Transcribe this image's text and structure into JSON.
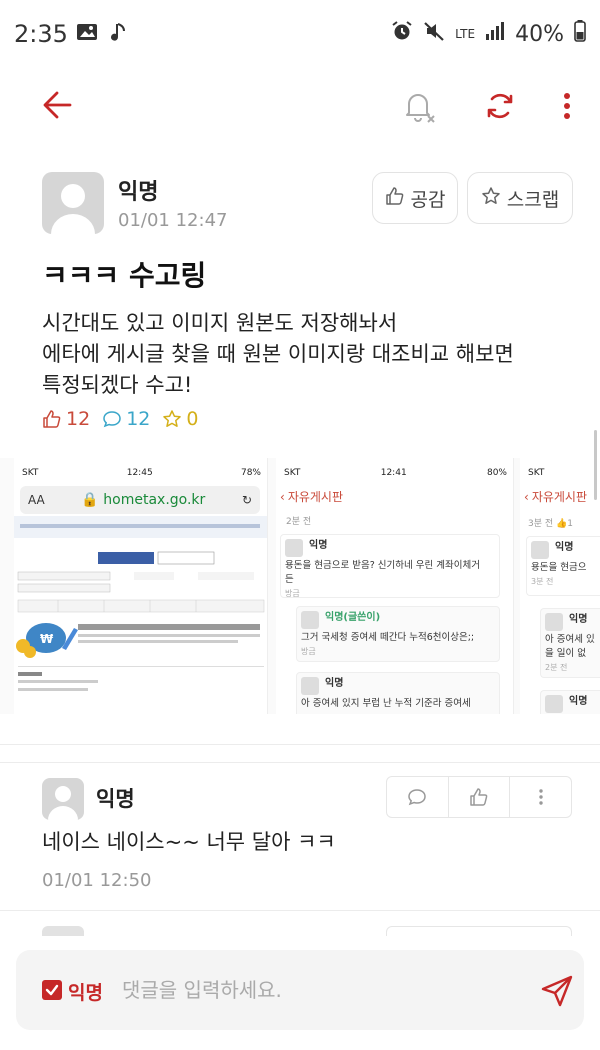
{
  "status_bar": {
    "time": "2:35",
    "network": "LTE",
    "battery": "40%",
    "icons": [
      "gallery-icon",
      "music-note-icon",
      "alarm-icon",
      "mute-icon",
      "signal-icon"
    ]
  },
  "app_bar": {
    "accent": "#c62828",
    "icons": [
      "back-arrow-icon",
      "bell-off-icon",
      "refresh-icon",
      "more-vertical-icon"
    ]
  },
  "post": {
    "author": "익명",
    "date": "01/01 12:47",
    "like_label": "공감",
    "scrap_label": "스크랩",
    "title": "ㅋㅋㅋ 수고링",
    "body_lines": [
      "시간대도 있고 이미지 원본도 저장해놔서",
      "에타에 게시글 찾을 때 원본 이미지랑 대조비교 해보면",
      "특정되겠다 수고!"
    ],
    "stats": {
      "likes": "12",
      "comments": "12",
      "scraps": "0"
    }
  },
  "image_strip": {
    "shot1": {
      "carrier": "SKT",
      "time": "12:45",
      "battery": "78%",
      "text_size": "AA",
      "url": "hometax.go.kr"
    },
    "shot2": {
      "carrier": "SKT",
      "time": "12:41",
      "battery": "80%",
      "board": "자유게시판",
      "meta": "2분 전",
      "c1_author": "익명",
      "c1_text": "용돈을 현금으로 받음? 신기하네 우린 계좌이체거",
      "c1_text2": "든",
      "c1_date": "방금",
      "c2_author": "익명(글쓴이)",
      "c2_text": "그거 국세청 증여세 떼간다 누적6천이상은;;",
      "c2_date": "방금",
      "c3_author": "익명",
      "c3_text": "아 증여세 있지 부럽 난 누적 기준라 증여세"
    },
    "shot3": {
      "carrier": "SKT",
      "board": "자유게시판",
      "meta": "3분 전",
      "likes": "1",
      "c1_author": "익명",
      "c1_text": "용돈을 현금으",
      "c1_date": "3분 전",
      "c2_author": "익명",
      "c2_text": "아 증여세 있",
      "c2_text2": "을 일이 없",
      "c2_date": "2분 전",
      "c3_author": "익명"
    }
  },
  "comment": {
    "author": "익명",
    "text": "네이스 네이스~~ 너무 달아 ㅋㅋ",
    "date": "01/01 12:50"
  },
  "input_bar": {
    "anonymous_label": "익명",
    "anonymous_checked": true,
    "placeholder": "댓글을 입력하세요."
  }
}
